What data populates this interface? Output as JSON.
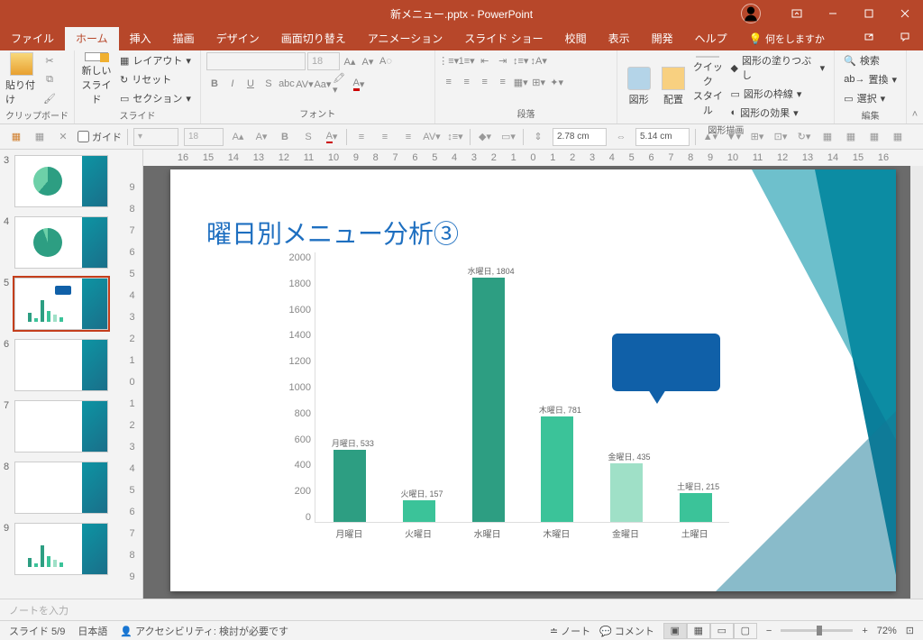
{
  "app": {
    "title": "新メニュー.pptx  -  PowerPoint"
  },
  "tabs": {
    "file": "ファイル",
    "home": "ホーム",
    "insert": "挿入",
    "draw": "描画",
    "design": "デザイン",
    "transitions": "画面切り替え",
    "animations": "アニメーション",
    "slideshow": "スライド ショー",
    "review": "校閲",
    "view": "表示",
    "developer": "開発",
    "help": "ヘルプ",
    "tellme": "何をしますか"
  },
  "ribbon": {
    "clipboard": {
      "label": "クリップボード",
      "paste": "貼り付け"
    },
    "slides": {
      "label": "スライド",
      "new": "新しい\nスライド",
      "layout": "レイアウト",
      "reset": "リセット",
      "section": "セクション"
    },
    "font": {
      "label": "フォント",
      "size": "18"
    },
    "paragraph": {
      "label": "段落"
    },
    "drawing": {
      "label": "図形描画",
      "shapes": "図形",
      "arrange": "配置",
      "quick": "クイック\nスタイル",
      "fill": "図形の塗りつぶし",
      "outline": "図形の枠線",
      "effects": "図形の効果"
    },
    "editing": {
      "label": "編集",
      "find": "検索",
      "replace": "置換",
      "select": "選択"
    }
  },
  "quickbar": {
    "guide": "ガイド",
    "font_size": "18",
    "dim_h": "2.78 cm",
    "dim_w": "5.14 cm"
  },
  "thumbs": [
    {
      "n": "3"
    },
    {
      "n": "4"
    },
    {
      "n": "5"
    },
    {
      "n": "6"
    },
    {
      "n": "7"
    },
    {
      "n": "8"
    },
    {
      "n": "9"
    }
  ],
  "slide": {
    "title": "曜日別メニュー分析③"
  },
  "chart_data": {
    "type": "bar",
    "title": "曜日別メニュー分析③",
    "categories": [
      "月曜日",
      "火曜日",
      "水曜日",
      "木曜日",
      "金曜日",
      "土曜日"
    ],
    "values": [
      533,
      157,
      1804,
      781,
      435,
      215
    ],
    "data_labels": [
      "月曜日, 533",
      "火曜日, 157",
      "水曜日, 1804",
      "木曜日, 781",
      "金曜日, 435",
      "土曜日, 215"
    ],
    "colors": [
      "#2d9e82",
      "#3bc399",
      "#2d9e82",
      "#3bc399",
      "#9fe0c7",
      "#3bc399"
    ],
    "ylim": [
      0,
      2000
    ],
    "yticks": [
      "2000",
      "1800",
      "1600",
      "1400",
      "1200",
      "1000",
      "800",
      "600",
      "400",
      "200",
      "0"
    ],
    "xlabel": "",
    "ylabel": ""
  },
  "notes": {
    "placeholder": "ノートを入力"
  },
  "status": {
    "slide": "スライド 5/9",
    "lang": "日本語",
    "accessibility": "アクセシビリティ: 検討が必要です",
    "notes_btn": "ノート",
    "comments": "コメント",
    "zoom": "72%"
  },
  "ruler_h": [
    "16",
    "15",
    "14",
    "13",
    "12",
    "11",
    "10",
    "9",
    "8",
    "7",
    "6",
    "5",
    "4",
    "3",
    "2",
    "1",
    "0",
    "1",
    "2",
    "3",
    "4",
    "5",
    "6",
    "7",
    "8",
    "9",
    "10",
    "11",
    "12",
    "13",
    "14",
    "15",
    "16"
  ],
  "ruler_v": [
    "9",
    "8",
    "7",
    "6",
    "5",
    "4",
    "3",
    "2",
    "1",
    "0",
    "1",
    "2",
    "3",
    "4",
    "5",
    "6",
    "7",
    "8",
    "9"
  ]
}
